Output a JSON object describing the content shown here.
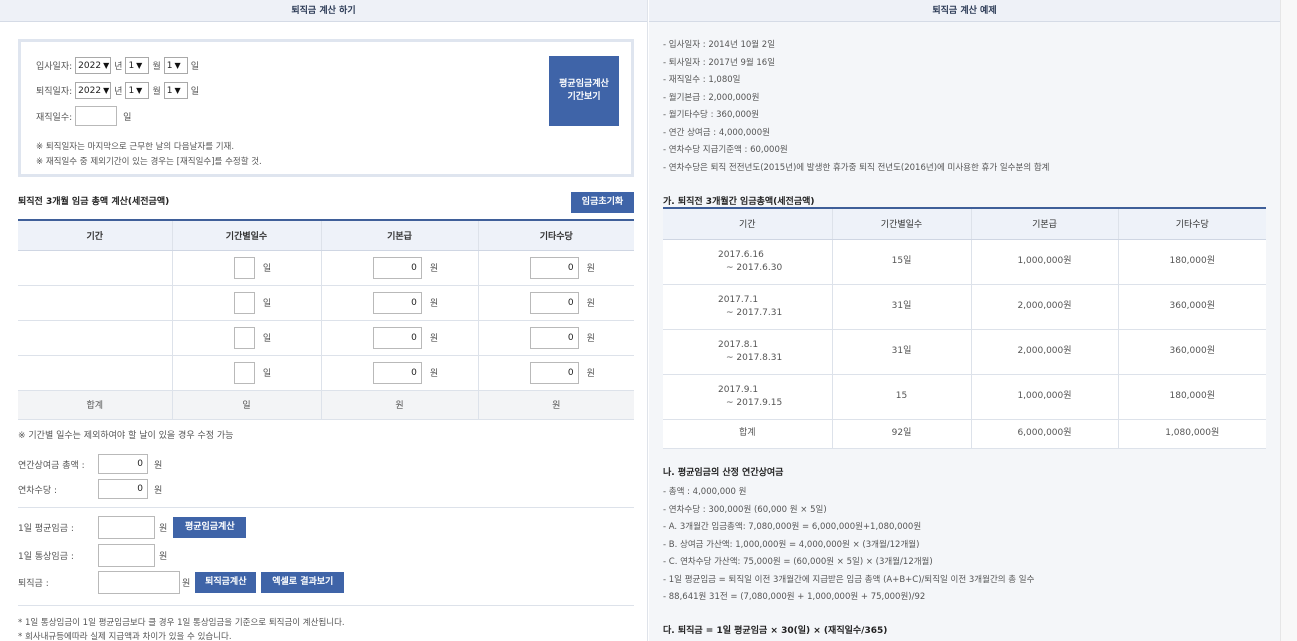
{
  "left": {
    "header": "퇴직금 계산 하기",
    "form": {
      "hire_label": "입사일자:",
      "leave_label": "퇴직일자:",
      "year_value": "2022",
      "year_unit": "년",
      "month_value": "1",
      "month_unit": "월",
      "day_value": "1",
      "day_unit": "일",
      "tenure_label": "재직일수:",
      "tenure_value": "",
      "tenure_unit": "일",
      "calc_button_line1": "평균임금계산",
      "calc_button_line2": "기간보기",
      "note1": "※ 퇴직일자는 마지막으로 근무한 날의 다음날자를 기재.",
      "note2": "※ 재직일수 중 제외기간이 있는 경우는 [재직일수]를 수정할 것."
    },
    "wage_section": {
      "title": "퇴직전 3개월 임금 총액 계산(세전금액)",
      "reset_button": "임금초기화",
      "columns": [
        "기간",
        "기간별일수",
        "기본급",
        "기타수당"
      ],
      "rows": [
        {
          "period": "",
          "days": "",
          "days_unit": "일",
          "base": "0",
          "base_unit": "원",
          "other": "0",
          "other_unit": "원"
        },
        {
          "period": "",
          "days": "",
          "days_unit": "일",
          "base": "0",
          "base_unit": "원",
          "other": "0",
          "other_unit": "원"
        },
        {
          "period": "",
          "days": "",
          "days_unit": "일",
          "base": "0",
          "base_unit": "원",
          "other": "0",
          "other_unit": "원"
        },
        {
          "period": "",
          "days": "",
          "days_unit": "일",
          "base": "0",
          "base_unit": "원",
          "other": "0",
          "other_unit": "원"
        }
      ],
      "sum": {
        "label": "합계",
        "days": "일",
        "base": "원",
        "other": "원"
      },
      "note": "※ 기간별 일수는 제외하여야 할 날이 있을 경우 수정 가능"
    },
    "bonus": {
      "annual_label": "연간상여금 총액 :",
      "annual_value": "0",
      "annual_unit": "원",
      "leave_allow_label": "연차수당 :",
      "leave_allow_value": "0",
      "leave_allow_unit": "원"
    },
    "result": {
      "avg_label": "1일 평균임금 :",
      "avg_unit": "원",
      "avg_button": "평균임금계산",
      "ordinary_label": "1일 통상임금 :",
      "ordinary_unit": "원",
      "severance_label": "퇴직금 :",
      "severance_unit": "원",
      "severance_button": "퇴직금계산",
      "excel_button": "엑셀로 결과보기",
      "foot1": "* 1일 통상임금이 1일 평균임금보다 클 경우 1일 통상임금을 기준으로 퇴직금이 계산됩니다.",
      "foot2": "* 회사내규등에따라 실제 지급액과 차이가 있을 수 있습니다."
    }
  },
  "right": {
    "header": "퇴직금 계산 예제",
    "info": [
      "- 입사일자 : 2014년 10월 2일",
      "- 퇴사일자 : 2017년 9월 16일",
      "- 재직일수 : 1,080일",
      "- 월기본급 : 2,000,000원",
      "- 월기타수당 : 360,000원",
      "- 연간 상여금 : 4,000,000원",
      "- 연차수당 지급기준액 : 60,000원",
      "- 연차수당은 퇴직 전전년도(2015년)에 발생한 휴가중 퇴직 전년도(2016년)에 미사용한 휴가 일수분의 합계"
    ],
    "table_title": "가. 퇴직전 3개월간 임금총액(세전금액)",
    "columns": [
      "기간",
      "기간별일수",
      "기본급",
      "기타수당"
    ],
    "rows": [
      {
        "from": "2017.6.16",
        "to": "~ 2017.6.30",
        "days": "15일",
        "base": "1,000,000원",
        "other": "180,000원"
      },
      {
        "from": "2017.7.1",
        "to": "~ 2017.7.31",
        "days": "31일",
        "base": "2,000,000원",
        "other": "360,000원"
      },
      {
        "from": "2017.8.1",
        "to": "~ 2017.8.31",
        "days": "31일",
        "base": "2,000,000원",
        "other": "360,000원"
      },
      {
        "from": "2017.9.1",
        "to": "~ 2017.9.15",
        "days": "15",
        "base": "1,000,000원",
        "other": "180,000원"
      }
    ],
    "sum": {
      "label": "합계",
      "days": "92일",
      "base": "6,000,000원",
      "other": "1,080,000원"
    },
    "calc_title": "나. 평균임금의 산정 연간상여금",
    "calc_lines": [
      "- 총액 : 4,000,000 원",
      "- 연차수당 : 300,000원 (60,000 원 × 5일)",
      "- A. 3개월간 임금총액: 7,080,000원 = 6,000,000원+1,080,000원",
      "- B. 상여금 가산액: 1,000,000원 = 4,000,000원 × (3개월/12개월)",
      "- C. 연차수당 가산액: 75,000원 = (60,000원 × 5일) × (3개월/12개월)",
      "- 1일 평균임금 = 퇴직일 이전 3개월간에 지급받은 임금 총액 (A+B+C)/퇴직일 이전 3개월간의 총 일수",
      "- 88,641원 31전 = (7,080,000원 + 1,000,000원 + 75,000원)/92"
    ],
    "formula_title": "다. 퇴직금 = 1일 평균임금 × 30(일) × (재직일수/365)"
  },
  "colors": {
    "accent": "#3f64a8",
    "header_bg": "#eef1f7",
    "right_bg": "#f4f6f9"
  }
}
